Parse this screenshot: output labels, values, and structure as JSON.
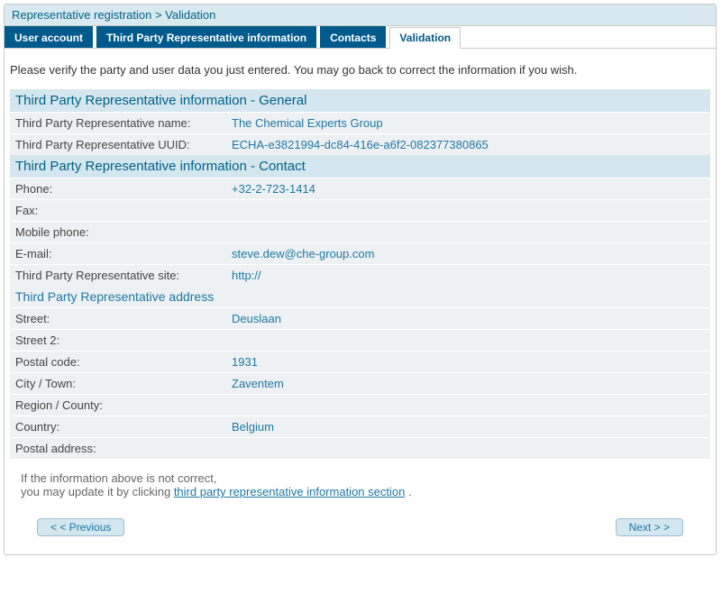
{
  "breadcrumb": "Representative registration > Validation",
  "tabs": [
    {
      "label": "User account"
    },
    {
      "label": "Third Party Representative information"
    },
    {
      "label": "Contacts"
    },
    {
      "label": "Validation"
    }
  ],
  "intro": "Please verify the party and user data you just entered. You may go back to correct the information if you wish.",
  "general_header": "Third Party Representative information - General",
  "general": {
    "name_label": "Third Party Representative name:",
    "name_value": "The Chemical Experts Group",
    "uuid_label": "Third Party Representative UUID:",
    "uuid_value": "ECHA-e3821994-dc84-416e-a6f2-082377380865"
  },
  "contact_header": "Third Party Representative information - Contact",
  "contact": {
    "phone_label": "Phone:",
    "phone_value": "+32-2-723-1414",
    "fax_label": "Fax:",
    "fax_value": "",
    "mobile_label": "Mobile phone:",
    "mobile_value": "",
    "email_label": "E-mail:",
    "email_value": "steve.dew@che-group.com",
    "site_label": "Third Party Representative site:",
    "site_value": "http://"
  },
  "address_header": "Third Party Representative address",
  "address": {
    "street_label": "Street:",
    "street_value": "Deuslaan",
    "street2_label": "Street 2:",
    "street2_value": "",
    "postal_label": "Postal code:",
    "postal_value": "1931",
    "city_label": "City / Town:",
    "city_value": "Zaventem",
    "region_label": "Region / County:",
    "region_value": "",
    "country_label": "Country:",
    "country_value": "Belgium",
    "postaladdr_label": "Postal address:",
    "postaladdr_value": ""
  },
  "footer": {
    "line1": "If the information above is not correct,",
    "line2a": "you may update it by clicking ",
    "link": "third party representative information section",
    "line2b": " ."
  },
  "buttons": {
    "prev": "< < Previous",
    "next": "Next > >"
  }
}
